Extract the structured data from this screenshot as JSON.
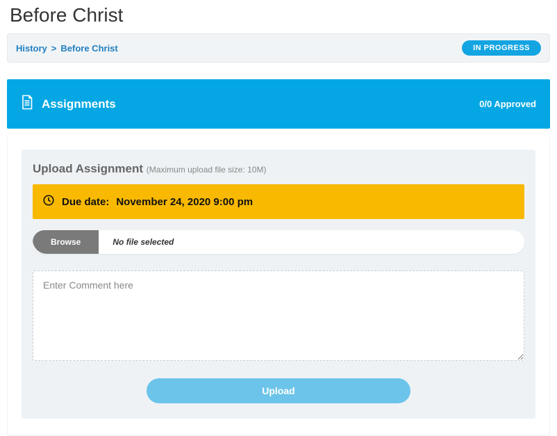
{
  "page": {
    "title": "Before Christ"
  },
  "breadcrumb": {
    "root": "History",
    "sep": ">",
    "current": "Before Christ"
  },
  "status": {
    "label": "IN PROGRESS"
  },
  "assignments": {
    "title": "Assignments",
    "approved_text": "0/0 Approved"
  },
  "upload": {
    "heading": "Upload Assignment",
    "note": "(Maximum upload file size: 10M)",
    "due_label": "Due date:",
    "due_value": "November 24, 2020 9:00 pm",
    "browse_label": "Browse",
    "file_status": "No file selected",
    "comment_placeholder": "Enter Comment here",
    "submit_label": "Upload"
  }
}
